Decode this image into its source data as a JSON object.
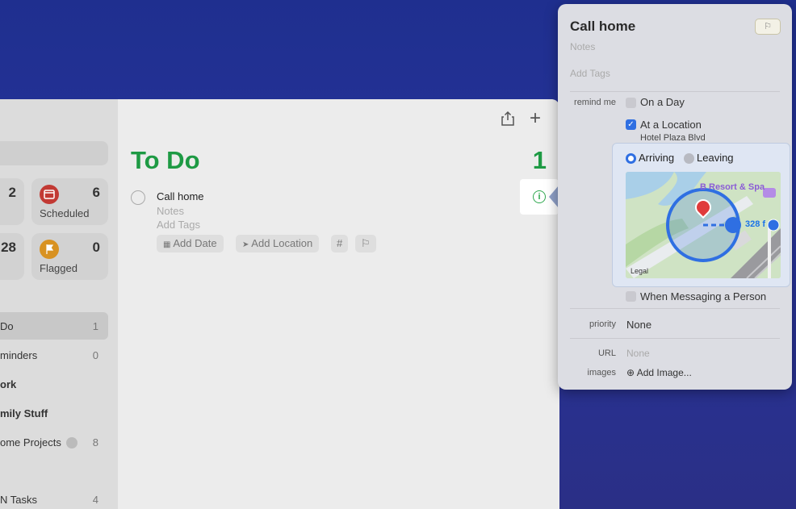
{
  "sidebar": {
    "smart_lists": [
      {
        "label": "",
        "count": "2"
      },
      {
        "label": "Scheduled",
        "count": "6",
        "color": "#e0403a"
      },
      {
        "label": "",
        "count": "28"
      },
      {
        "label": "Flagged",
        "count": "0",
        "color": "#f0a020"
      }
    ],
    "lists": [
      {
        "label": "Do",
        "count": "1"
      },
      {
        "label": "minders",
        "count": "0"
      },
      {
        "label": "ork",
        "count": ""
      },
      {
        "label": "mily Stuff",
        "count": ""
      },
      {
        "label": "ome Projects",
        "count": "8"
      },
      {
        "label": "N Tasks",
        "count": "4"
      }
    ]
  },
  "main": {
    "title": "To Do",
    "count": "1",
    "share_icon": "⇪",
    "add_icon": "+",
    "task": {
      "title": "Call home",
      "notes": "Notes",
      "tags": "Add Tags",
      "chips": {
        "date": "Add Date",
        "location": "Add Location",
        "tag": "#",
        "flag": "⚐"
      }
    }
  },
  "info_button": {
    "icon": "i"
  },
  "popover": {
    "title": "Call home",
    "flag_icon": "⚐",
    "notes_placeholder": "Notes",
    "tags_placeholder": "Add Tags",
    "remind_label": "remind me",
    "on_a_day": "On a Day",
    "at_a_location": "At a Location",
    "location_name": "Hotel Plaza Blvd",
    "when_messaging": "When Messaging a Person",
    "priority_label": "priority",
    "priority_value": "None",
    "url_label": "URL",
    "url_value": "None",
    "images_label": "images",
    "add_image": "Add Image..."
  },
  "location": {
    "arriving": "Arriving",
    "leaving": "Leaving",
    "map": {
      "place": "B Resort & Spa",
      "distance": "328 f",
      "legal": "Legal"
    }
  }
}
